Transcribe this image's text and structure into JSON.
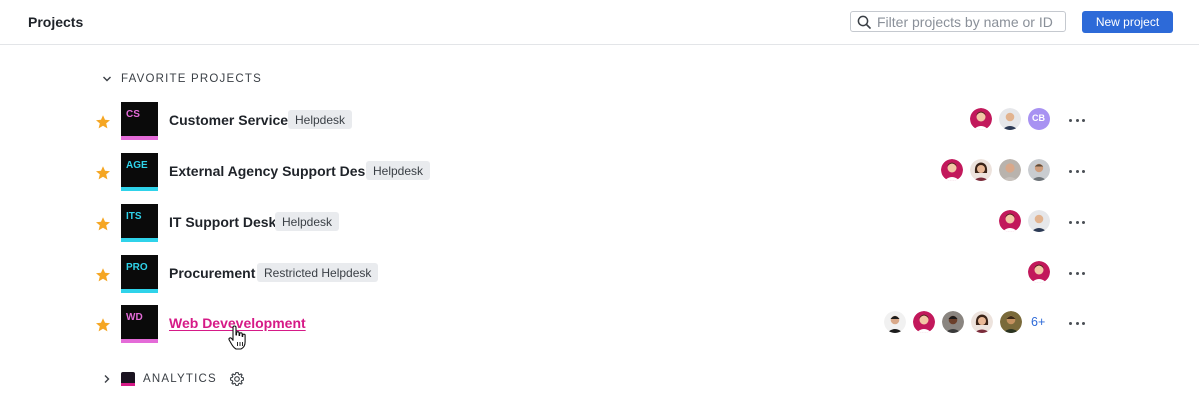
{
  "header": {
    "title": "Projects",
    "search_placeholder": "Filter projects by name or ID",
    "new_project_label": "New project",
    "accent": "#2d6ad8"
  },
  "favorites_section": {
    "label": "FAVORITE PROJECTS",
    "expanded": true
  },
  "projects": [
    {
      "abbr": "CS",
      "abbr_color": "#e46bd8",
      "bar_color": "#e46bd8",
      "name": "Customer Service",
      "tag": "Helpdesk",
      "favorite": true,
      "members": [
        "avatar-1",
        "avatar-2",
        "CB"
      ]
    },
    {
      "abbr": "AGE",
      "abbr_color": "#2fd3ea",
      "bar_color": "#2fd3ea",
      "name": "External Agency Support Desk",
      "tag": "Helpdesk",
      "favorite": true,
      "members": [
        "avatar-1",
        "avatar-3",
        "avatar-4",
        "avatar-5"
      ]
    },
    {
      "abbr": "ITS",
      "abbr_color": "#2fd3ea",
      "bar_color": "#2fd3ea",
      "name": "IT Support Desk",
      "tag": "Helpdesk",
      "favorite": true,
      "members": [
        "avatar-1",
        "avatar-2"
      ]
    },
    {
      "abbr": "PRO",
      "abbr_color": "#2fd3ea",
      "bar_color": "#2fd3ea",
      "name": "Procurement",
      "tag": "Restricted Helpdesk",
      "favorite": true,
      "members": [
        "avatar-1"
      ]
    },
    {
      "abbr": "WD",
      "abbr_color": "#e46bd8",
      "bar_color": "#e46bd8",
      "name": "Web Devevelopment",
      "tag": "",
      "favorite": true,
      "hovered": true,
      "members": [
        "avatar-6",
        "avatar-1",
        "avatar-7",
        "avatar-3",
        "avatar-8"
      ],
      "more_members": "6+"
    }
  ],
  "groups": [
    {
      "label": "ANALYTICS",
      "expanded": false
    }
  ],
  "colors": {
    "star": "#f5a623",
    "link": "#d61a87",
    "tag_bg": "#e9ebee"
  }
}
